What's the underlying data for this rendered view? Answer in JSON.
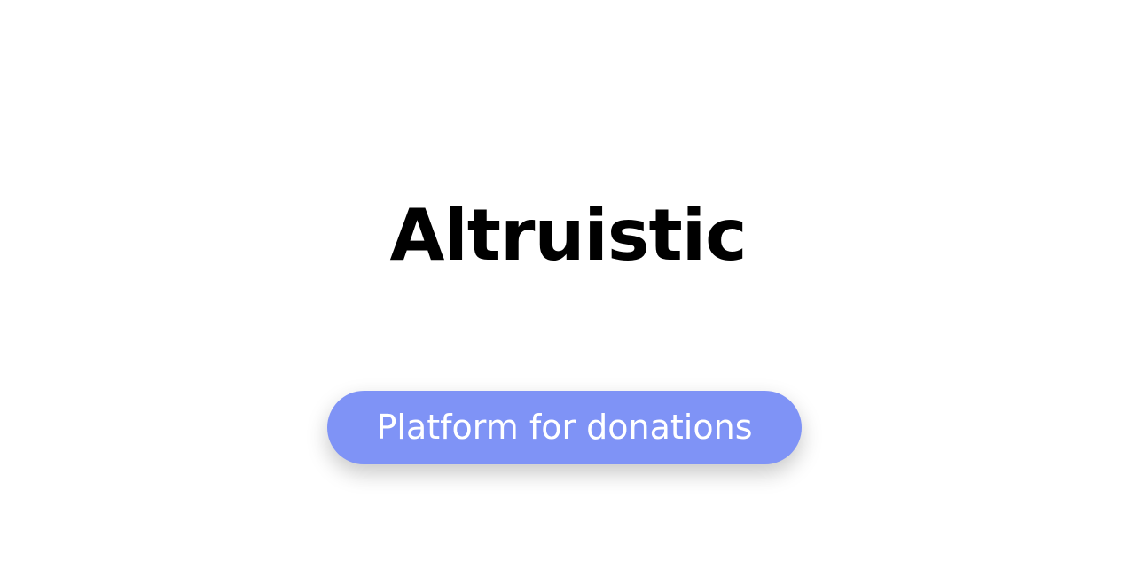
{
  "hero": {
    "title": "Altruistic",
    "cta_label": "Platform for donations"
  },
  "colors": {
    "background": "#ffffff",
    "title": "#000000",
    "cta_background": "#7f93f6",
    "cta_text": "#ffffff"
  }
}
